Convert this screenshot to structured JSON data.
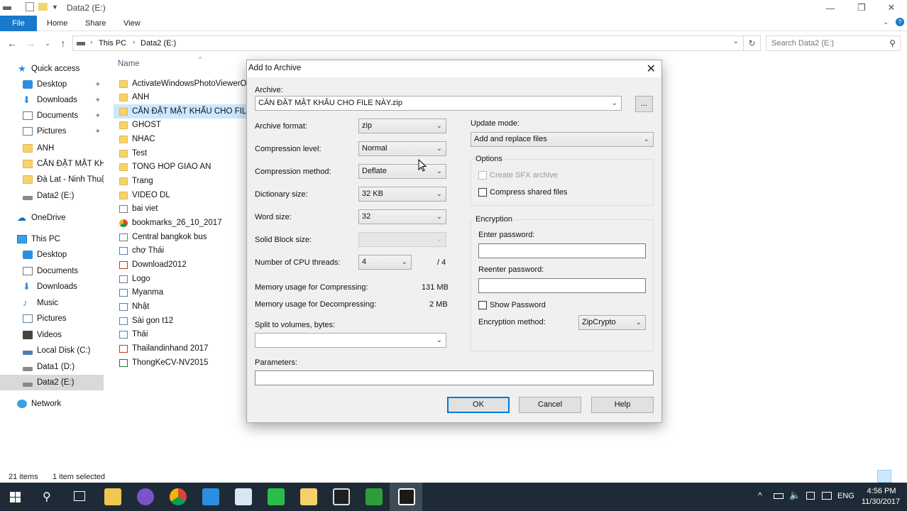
{
  "window": {
    "title": "Data2 (E:)",
    "minimize": "—",
    "restore": "❐",
    "close": "✕"
  },
  "ribbon": {
    "tabs": [
      "File",
      "Home",
      "Share",
      "View"
    ]
  },
  "address": {
    "crumbs": [
      "This PC",
      "Data2 (E:)"
    ],
    "search_placeholder": "Search Data2 (E:)"
  },
  "nav": {
    "quick_access": "Quick access",
    "quick_items": [
      "Desktop",
      "Downloads",
      "Documents",
      "Pictures",
      "ANH",
      "CĂN ĐẶT MẬT KHẨU",
      "Đà Lat - Ninh Thuận",
      "Data2 (E:)"
    ],
    "onedrive": "OneDrive",
    "this_pc": "This PC",
    "pc_items": [
      "Desktop",
      "Documents",
      "Downloads",
      "Music",
      "Pictures",
      "Videos",
      "Local Disk (C:)",
      "Data1 (D:)",
      "Data2 (E:)"
    ],
    "network": "Network"
  },
  "files": {
    "header": "Name",
    "items": [
      "ActivateWindowsPhotoViewerOn",
      "ANH",
      "CĂN ĐẶT MẬT KHẨU CHO FILE",
      "GHOST",
      "NHAC",
      "Test",
      "TONG HOP GIAO AN",
      "Trang",
      "VIDEO DL",
      "bai viet",
      "bookmarks_26_10_2017",
      "Central bangkok bus",
      "chợ Thái",
      "Download2012",
      "Logo",
      "Myanma",
      "Nhật",
      "Sài gon t12",
      "Thái",
      "Thailandinhand 2017",
      "ThongKeCV-NV2015"
    ]
  },
  "status": {
    "count": "21 items",
    "selected": "1 item selected"
  },
  "dialog": {
    "title": "Add to Archive",
    "archive_label": "Archive:",
    "archive_value": "CĂN ĐẶT MẬT KHẨU CHO FILE NÀY.zip",
    "browse": "...",
    "format_label": "Archive format:",
    "format_value": "zip",
    "level_label": "Compression level:",
    "level_value": "Normal",
    "method_label": "Compression method:",
    "method_value": "Deflate",
    "dict_label": "Dictionary size:",
    "dict_value": "32 KB",
    "word_label": "Word size:",
    "word_value": "32",
    "solid_label": "Solid Block size:",
    "threads_label": "Number of CPU threads:",
    "threads_value": "4",
    "threads_max": "/ 4",
    "mem_comp_label": "Memory usage for Compressing:",
    "mem_comp_value": "131 MB",
    "mem_decomp_label": "Memory usage for Decompressing:",
    "mem_decomp_value": "2 MB",
    "split_label": "Split to volumes, bytes:",
    "update_label": "Update mode:",
    "update_value": "Add and replace files",
    "options_label": "Options",
    "sfx_label": "Create SFX archive",
    "shared_label": "Compress shared files",
    "enc_label": "Encryption",
    "enter_pw": "Enter password:",
    "reenter_pw": "Reenter password:",
    "show_pw": "Show Password",
    "enc_method_label": "Encryption method:",
    "enc_method_value": "ZipCrypto",
    "params_label": "Parameters:",
    "ok": "OK",
    "cancel": "Cancel",
    "help": "Help"
  },
  "taskbar": {
    "lang": "ENG",
    "time": "4:56 PM",
    "date": "11/30/2017"
  }
}
